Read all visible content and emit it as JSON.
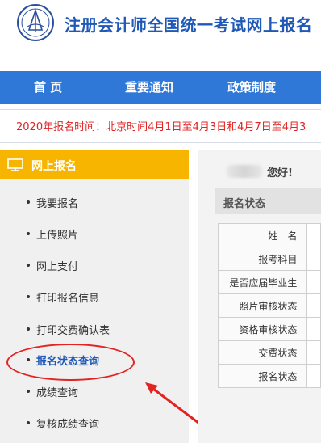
{
  "header": {
    "site_title": "注册会计师全国统一考试网上报名"
  },
  "nav": {
    "items": [
      {
        "label": "首 页"
      },
      {
        "label": "重要通知"
      },
      {
        "label": "政策制度"
      }
    ]
  },
  "notice": {
    "text": "2020年报名时间：北京时间4月1日至4月3日和4月7日至4月3"
  },
  "sidebar": {
    "title": "网上报名",
    "items": [
      {
        "label": "我要报名"
      },
      {
        "label": "上传照片"
      },
      {
        "label": "网上支付"
      },
      {
        "label": "打印报名信息"
      },
      {
        "label": "打印交费确认表"
      },
      {
        "label": "报名状态查询",
        "active": true
      },
      {
        "label": "成绩查询"
      },
      {
        "label": "复核成绩查询"
      }
    ]
  },
  "main": {
    "greeting": "您好!",
    "section_title": "报名状态",
    "rows": [
      {
        "label": "姓　名"
      },
      {
        "label": "报考科目"
      },
      {
        "label": "是否应届毕业生"
      },
      {
        "label": "照片审核状态"
      },
      {
        "label": "资格审核状态"
      },
      {
        "label": "交费状态"
      },
      {
        "label": "报名状态"
      }
    ]
  },
  "colors": {
    "nav_bg": "#2f78d8",
    "title_blue": "#1f58b6",
    "sidebar_header": "#f7b500",
    "notice_red": "#e02424",
    "annotation_red": "#e32222"
  }
}
